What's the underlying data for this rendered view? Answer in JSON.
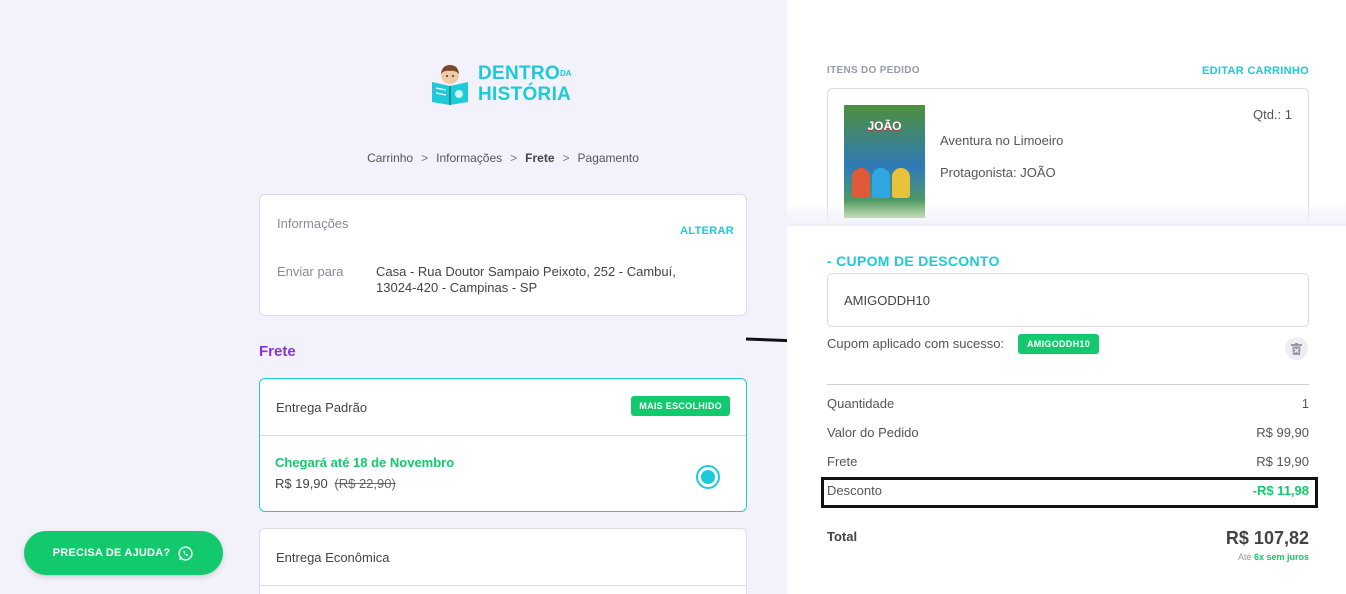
{
  "brand": {
    "line1": "DENTRO",
    "small": "DA",
    "line2": "HISTÓRIA",
    "accent": "#1ccad8",
    "green": "#13c96d",
    "purple": "#8b33d6"
  },
  "breadcrumb": {
    "step1": "Carrinho",
    "step2": "Informações",
    "step3": "Frete",
    "step4": "Pagamento",
    "sep": ">"
  },
  "info": {
    "title": "Informações",
    "change_label": "ALTERAR",
    "ship_label": "Enviar para",
    "address": "Casa - Rua Doutor Sampaio Peixoto, 252 - Cambuí, 13024-420 - Campinas - SP"
  },
  "shipping": {
    "title": "Frete",
    "option1": {
      "name": "Entrega Padrão",
      "badge": "MAIS ESCOLHIDO",
      "eta": "Chegará até 18 de Novembro",
      "price": "R$ 19,90",
      "old_price": "(R$ 22,90)",
      "selected": true
    },
    "option2": {
      "name": "Entrega Econômica"
    }
  },
  "help": {
    "label": "PRECISA DE AJUDA?",
    "icon": "whatsapp-icon"
  },
  "order": {
    "items_title": "ITENS DO PEDIDO",
    "edit_label": "EDITAR CARRINHO",
    "item": {
      "cover_title": "JOÃO",
      "qty": "Qtd.: 1",
      "name": "Aventura no Limoeiro",
      "protagonist": "Protagonista: JOÃO"
    }
  },
  "coupon": {
    "title": "- CUPOM DE DESCONTO",
    "value": "AMIGODDH10",
    "success": "Cupom aplicado com sucesso:",
    "badge": "AMIGODDH10"
  },
  "summary": {
    "qty_label": "Quantidade",
    "qty_value": "1",
    "order_label": "Valor do Pedido",
    "order_value": "R$ 99,90",
    "freight_label": "Frete",
    "freight_value": "R$ 19,90",
    "discount_label": "Desconto",
    "discount_value": "-R$ 11,98",
    "total_label": "Total",
    "total_value": "R$ 107,82",
    "inst_prefix": "Até",
    "inst_value": "6x sem juros"
  }
}
